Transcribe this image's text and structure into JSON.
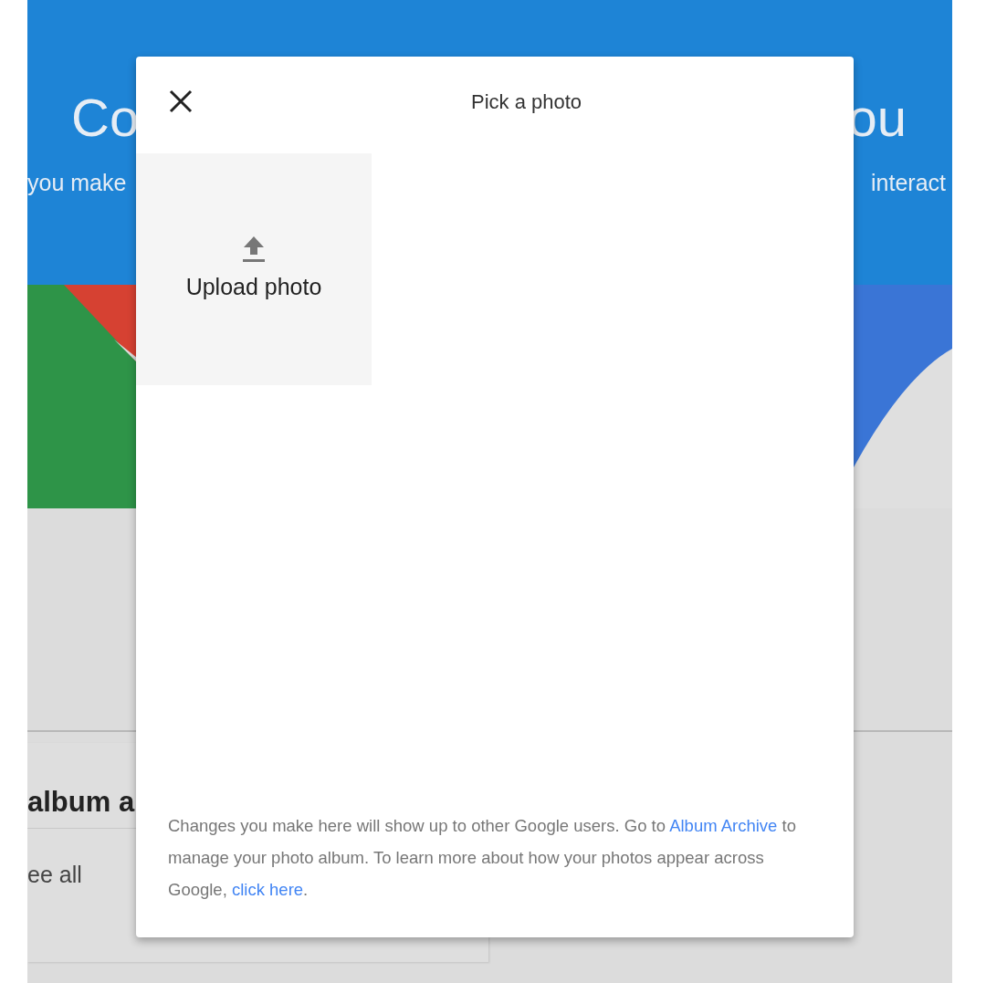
{
  "background": {
    "hero_title": [
      "Co",
      "ou"
    ],
    "hero_subtitle": [
      "you make",
      "interact"
    ],
    "card_title": "album a",
    "card_link": "ee all"
  },
  "dialog": {
    "title": "Pick a photo",
    "upload_tile": {
      "label": "Upload photo"
    },
    "footer": [
      {
        "kind": "text",
        "text": "Changes you make here will show up to other Google users. Go to "
      },
      {
        "kind": "link",
        "text": "Album Archive"
      },
      {
        "kind": "text",
        "text": " to manage your photo album. To learn more about how your photos appear across Google, "
      },
      {
        "kind": "link",
        "text": "click here"
      },
      {
        "kind": "text",
        "text": "."
      }
    ]
  }
}
